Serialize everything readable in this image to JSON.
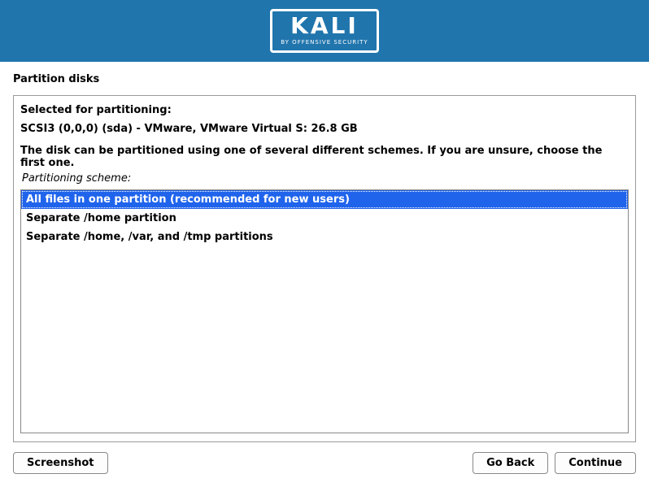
{
  "logo": {
    "main": "KALI",
    "sub": "BY OFFENSIVE SECURITY"
  },
  "page_title": "Partition disks",
  "info_label": "Selected for partitioning:",
  "disk_info": "SCSI3 (0,0,0) (sda) - VMware, VMware Virtual S: 26.8 GB",
  "description": "The disk can be partitioned using one of several different schemes. If you are unsure, choose the first one.",
  "scheme_label": "Partitioning scheme:",
  "options": [
    "All files in one partition (recommended for new users)",
    "Separate /home partition",
    "Separate /home, /var, and /tmp partitions"
  ],
  "selected_index": 0,
  "buttons": {
    "screenshot": "Screenshot",
    "go_back": "Go Back",
    "continue": "Continue"
  }
}
